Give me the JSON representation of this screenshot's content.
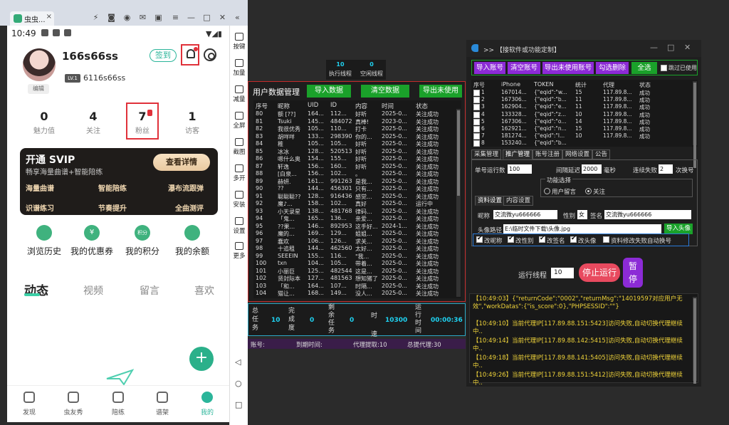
{
  "emulator": {
    "tab_title": "虫虫...",
    "sidebar": [
      "按键",
      "加量",
      "减量",
      "全屏",
      "截图",
      "多开",
      "安装",
      "设置",
      "更多"
    ]
  },
  "phone": {
    "time": "10:49",
    "username": "166s66ss",
    "edit": "编辑",
    "level": "LV.1",
    "uid": "6116s66ss",
    "signin": "签到",
    "stats": [
      {
        "num": "0",
        "label": "魅力值"
      },
      {
        "num": "4",
        "label": "关注"
      },
      {
        "num": "7",
        "label": "粉丝"
      },
      {
        "num": "1",
        "label": "访客"
      }
    ],
    "svip": {
      "title": "开通 SVIP",
      "subtitle": "畅享海量曲谱+智能陪练",
      "button": "查看详情",
      "features": [
        "海量曲谱",
        "智能陪练",
        "瀑布流跟弹",
        "识谱练习",
        "节奏提升",
        "全曲测评"
      ]
    },
    "quick": [
      {
        "label": "浏览历史",
        "icon": "clock-icon",
        "glyph": ""
      },
      {
        "label": "我的优惠券",
        "icon": "coupon-icon",
        "glyph": "¥"
      },
      {
        "label": "我的积分",
        "icon": "points-icon",
        "glyph": "积分"
      },
      {
        "label": "我的余额",
        "icon": "wallet-icon",
        "glyph": ""
      }
    ],
    "tabs": [
      "动态",
      "视频",
      "留言",
      "喜欢"
    ],
    "nav": [
      "发现",
      "虫友秀",
      "陪练",
      "谱架",
      "我的"
    ]
  },
  "mid": {
    "top_stats": [
      {
        "value": "10",
        "label": "执行线程"
      },
      {
        "value": "0",
        "label": "空闲线程"
      }
    ],
    "title": "用户数据管理",
    "buttons": [
      "导入数据",
      "清空数据",
      "导出未使用"
    ],
    "headers": [
      "序号",
      "昵称",
      "UID",
      "ID",
      "内容",
      "时间",
      "状态"
    ],
    "rows": [
      [
        "80",
        "额 [??]",
        "164...",
        "112...",
        "好听",
        "2025-0...",
        "关注成功"
      ],
      [
        "81",
        "Tsuki",
        "145...",
        "484072",
        "真棒!",
        "2023-0...",
        "关注成功"
      ],
      [
        "82",
        "我很优秀",
        "105...",
        "110...",
        "打卡",
        "2025-0...",
        "关注成功"
      ],
      [
        "83",
        "胡咩咩",
        "133...",
        "298390",
        "你的...",
        "2025-0...",
        "关注成功"
      ],
      [
        "84",
        "稚",
        "105...",
        "105...",
        "好听",
        "2025-0...",
        "关注成功"
      ],
      [
        "85",
        "冰冰",
        "128...",
        "520513",
        "好听",
        "2025-0...",
        "关注成功"
      ],
      [
        "86",
        "嗯什么奥",
        "154...",
        "155...",
        "好听",
        "2025-0...",
        "关注成功"
      ],
      [
        "87",
        "轩逸",
        "156...",
        "160...",
        "好听",
        "2025-0...",
        "关注成功"
      ],
      [
        "88",
        "[白泉...",
        "156...",
        "102...",
        "。",
        "2025-0...",
        "关注成功"
      ],
      [
        "89",
        "赫妍.",
        "161...",
        "991263",
        "是我...",
        "2025-0...",
        "关注成功"
      ],
      [
        "90",
        "??",
        "144...",
        "456301",
        "只有...",
        "2025-0...",
        "关注成功"
      ],
      [
        "91",
        "聪聪聪??",
        "128...",
        "916436",
        "感觉...",
        "2025-0...",
        "关注成功"
      ],
      [
        "92",
        "魔♪...",
        "158...",
        "102...",
        "真好",
        "2025-0...",
        "运行中"
      ],
      [
        "93",
        "小天录星",
        "138...",
        "481768",
        "律码...",
        "2025-0...",
        "关注成功"
      ],
      [
        "94",
        "「鬼...",
        "165...",
        "136...",
        "亲爱...",
        "2025-0...",
        "关注成功"
      ],
      [
        "95",
        "??果...",
        "146...",
        "892953",
        "这手好...",
        "2024-1...",
        "关注成功"
      ],
      [
        "96",
        "魔的...",
        "169...",
        "129...",
        "姐姐...",
        "2025-0...",
        "关注成功"
      ],
      [
        "97",
        "蠢欢",
        "106...",
        "126...",
        "求关...",
        "2025-0...",
        "关注成功"
      ],
      [
        "98",
        "十追租",
        "144...",
        "462560",
        "太好...",
        "2025-0...",
        "关注成功"
      ],
      [
        "99",
        "SEEEIN",
        "155...",
        "116...",
        "\"我...",
        "2025-0...",
        "关注成功"
      ],
      [
        "100",
        "txn",
        "104...",
        "105...",
        "带着...",
        "2025-0...",
        "关注成功"
      ],
      [
        "101",
        "小丽巨",
        "125...",
        "482544",
        "这是...",
        "2025-0...",
        "关注成功"
      ],
      [
        "102",
        "贤封际本",
        "127...",
        "481563",
        "想知猪了",
        "2025-0...",
        "关注成功"
      ],
      [
        "103",
        "「和...",
        "164...",
        "107...",
        "时隔...",
        "2025-0...",
        "关注成功"
      ],
      [
        "104",
        "猫让...",
        "168...",
        "149...",
        "没人...",
        "2025-0...",
        "关注成功"
      ]
    ],
    "stats": {
      "total_label": "总任务",
      "total": "10",
      "done_label": "完成度",
      "done": "0",
      "remain_label": "剩余任务",
      "remain": "0",
      "speed_label": "时速",
      "speed": "10300",
      "runtime_label": "运行时间",
      "runtime": "00:00:36"
    },
    "footer": [
      "账号:",
      "到期时间:",
      "代理提取:10",
      "总提代理:30"
    ]
  },
  "right": {
    "title": ">> 【接软件或功能定制】",
    "toolbar": [
      "导入账号",
      "清空账号",
      "导出未使用账号",
      "勾选删除",
      "全选"
    ],
    "skip_used": "跳过已使用",
    "headers": [
      "序号",
      "iPhone",
      "TOKEN",
      "统计",
      "代理",
      "状态"
    ],
    "rows": [
      [
        "1",
        "167014...",
        "{\"eqid\":\"w...",
        "15",
        "117.89.8...",
        "成功"
      ],
      [
        "2",
        "167306...",
        "{\"eqid\":\"b...",
        "11",
        "117.89.8...",
        "成功"
      ],
      [
        "3",
        "162904...",
        "{\"eqid\":\"e...",
        "11",
        "117.89.8...",
        "成功"
      ],
      [
        "4",
        "133328...",
        "{\"eqid\":\"z...",
        "10",
        "117.89.8...",
        "成功"
      ],
      [
        "5",
        "167306...",
        "{\"eqid\":\"o...",
        "14",
        "117.89.8...",
        "成功"
      ],
      [
        "6",
        "162921...",
        "{\"eqid\":\"n...",
        "15",
        "117.89.8...",
        "成功"
      ],
      [
        "7",
        "181274...",
        "{\"eqid\":\"l...",
        "10",
        "117.89.8...",
        "成功"
      ],
      [
        "8",
        "153240...",
        "{\"eqid\":\"b...",
        "",
        "",
        ""
      ]
    ],
    "tabs": [
      "采集管理",
      "推广管理",
      "账号注册",
      "网络设置",
      "公告"
    ],
    "single_threads_label": "单号运行数",
    "single_threads": "100",
    "interval_label": "间隔延迟",
    "interval": "2000",
    "interval_unit": "毫秒",
    "fail_label": "连续失败",
    "fail": "2",
    "fail_unit": "次换号",
    "func_label": "功能选择",
    "radio_comment": "用户留言",
    "radio_follow": "关注",
    "subtabs": [
      "资料设置",
      "内容设置"
    ],
    "nick_label": "昵称",
    "nick": "交流微yu666666",
    "gender_label": "性别",
    "gender": "女",
    "sign_label": "签名",
    "sign": "交流微yu666666",
    "avatar_label": "头像路径",
    "avatar_path": "E:\\临时文件下载\\头像.jpg",
    "import_avatar": "导入头像",
    "checks": [
      "改昵称",
      "改性别",
      "改签名",
      "改头像"
    ],
    "auto_swap": "资料修改失败自动换号",
    "run_thread_label": "运行线程",
    "run_thread": "10",
    "stop": "停止运行",
    "pause": "暂停",
    "log": [
      "【10:49:03】{\"returnCode\":\"0002\",\"returnMsg\":\"14019597对应用户无效\",\"workDatas\":{\"is_score\":0},\"PHPSESSID\":\"\"}",
      "【10:49:10】当前代理IP[117.89.88.151:5423]访问失败,自动切换代理继续中..",
      "【10:49:14】当前代理IP[117.89.88.142:5415]访问失败,自动切换代理继续中..",
      "【10:49:18】当前代理IP[117.89.88.141:5405]访问失败,自动切换代理继续中..",
      "【10:49:26】当前代理IP[117.89.88.151:5412]访问失败,自动切换代理继续中.."
    ]
  }
}
